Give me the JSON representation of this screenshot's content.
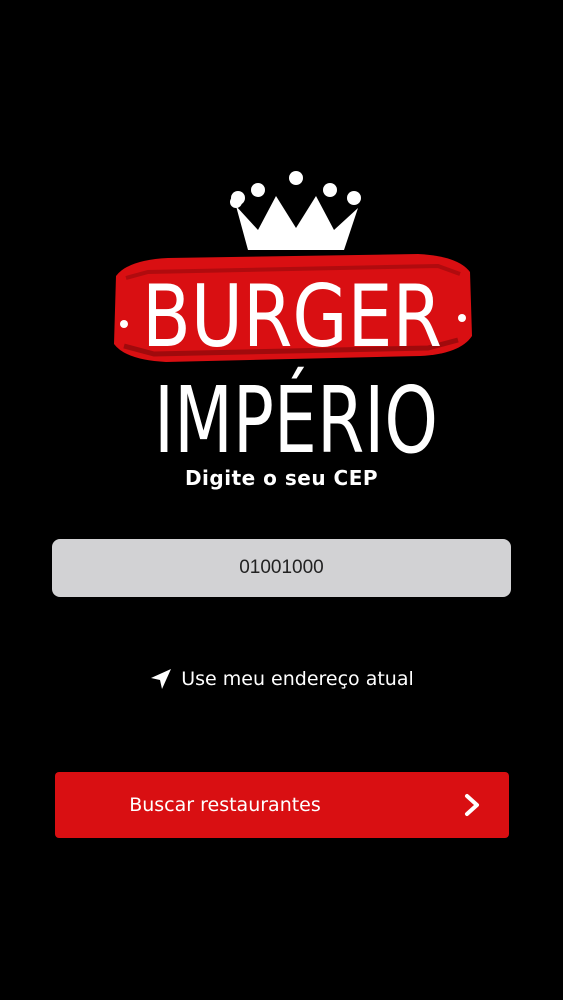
{
  "brand": {
    "line1": "BURGER",
    "line2": "IMPÉRIO",
    "colors": {
      "banner_red": "#d90f12",
      "text_white": "#ffffff",
      "background": "#000000"
    }
  },
  "prompt": {
    "text": "Digite o seu CEP"
  },
  "cep_input": {
    "value": "01001000"
  },
  "location_link": {
    "icon": "navigation-arrow-icon",
    "label": "Use meu endereço atual"
  },
  "search_button": {
    "label": "Buscar restaurantes",
    "icon": "chevron-right-icon",
    "color": "#d90f12"
  }
}
